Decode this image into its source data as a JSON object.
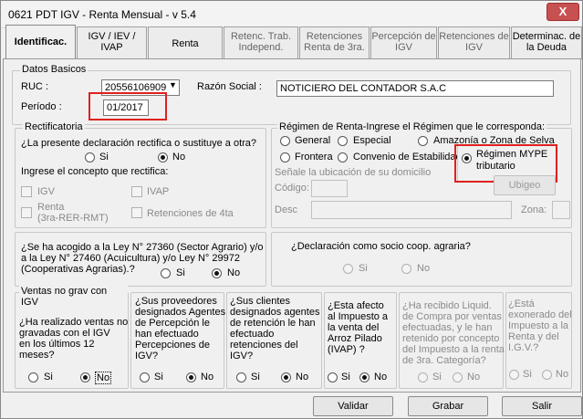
{
  "window": {
    "title": "0621 PDT IGV - Renta Mensual - v 5.4",
    "close_glyph": "X"
  },
  "tabs": [
    {
      "label": "Identificac."
    },
    {
      "label": "IGV / IEV / IVAP"
    },
    {
      "label": "Renta"
    },
    {
      "label": "Retenc. Trab. Independ."
    },
    {
      "label": "Retenciones Renta de 3ra."
    },
    {
      "label": "Percepción de IGV"
    },
    {
      "label": "Retenciones de IGV"
    },
    {
      "label": "Determinac. de la Deuda"
    }
  ],
  "datos_basicos": {
    "title": "Datos Basicos",
    "ruc_label": "RUC :",
    "ruc_value": "20556106909",
    "razon_label": "Razón Social :",
    "razon_value": "NOTICIERO DEL CONTADOR S.A.C",
    "periodo_label": "Período :",
    "periodo_value": "01/2017"
  },
  "rectificatoria": {
    "title": "Rectificatoria",
    "question": "¿La presente declaración rectifica o sustituye a otra?",
    "si": "Si",
    "no": "No",
    "concepto_label": "Ingrese el concepto que rectifica:",
    "igv": "IGV",
    "ivap": "IVAP",
    "renta_l1": "Renta",
    "renta_l2": "(3ra-RER-RMT)",
    "retenciones": "Retenciones de 4ta"
  },
  "regimen": {
    "title": "Régimen de Renta-Ingrese el Régimen que le corresponda:",
    "general": "General",
    "especial": "Especial",
    "amazonia": "Amazonía o Zona de Selva",
    "frontera": "Frontera",
    "convenio": "Convenio de Estabilidad",
    "mype_l1": "Régimen MYPE",
    "mype_l2": "tributario",
    "ubicacion_label": "Señale la ubicación de su domicilio",
    "codigo_label": "Código:",
    "ubigeo_btn": "Ubigeo",
    "desc_label": "Desc",
    "zona_label": "Zona:"
  },
  "ley": {
    "q_l1": "¿Se ha acogido a la Ley N° 27360 (Sector Agrario) y/o",
    "q_l2": "a la Ley N° 27460 (Acuicultura) y/o Ley N° 29972",
    "q_l3": "(Cooperativas Agrarias).?",
    "si": "Si",
    "no": "No"
  },
  "socio": {
    "question": "¿Declaración como socio coop. agraria?",
    "si": "Si",
    "no": "No"
  },
  "ventas": {
    "title": "Ventas no grav con IGV",
    "c1": [
      "¿Ha realizado ventas no",
      "gravadas   con el IGV",
      "en los últimos 12",
      "meses?"
    ],
    "c2": [
      "¿Sus proveedores",
      "designados Agentes",
      "de Percepción le",
      "han efectuado",
      "Percepciones de",
      "IGV?"
    ],
    "c3": [
      "¿Sus clientes",
      "designados agentes",
      "de retención le han",
      "efectuado",
      "retenciones del",
      "IGV?"
    ],
    "c4": [
      "¿Esta   afecto",
      "al Impuesto  a",
      "la venta del",
      "Arroz Pilado",
      "(IVAP) ?"
    ],
    "c5": [
      "¿Ha recibido Liquid.",
      "de Compra por ventas",
      "efectuadas, y le han",
      "retenido por concepto",
      "del Impuesto a la renta",
      "de 3ra. Categoría?"
    ],
    "c6": [
      "¿Está",
      "exonerado del",
      "Impuesto a la",
      "Renta y del",
      "I.G.V.?"
    ],
    "si": "Si",
    "no": "No"
  },
  "buttons": {
    "validar": "Validar",
    "grabar": "Grabar",
    "salir": "Salir"
  }
}
